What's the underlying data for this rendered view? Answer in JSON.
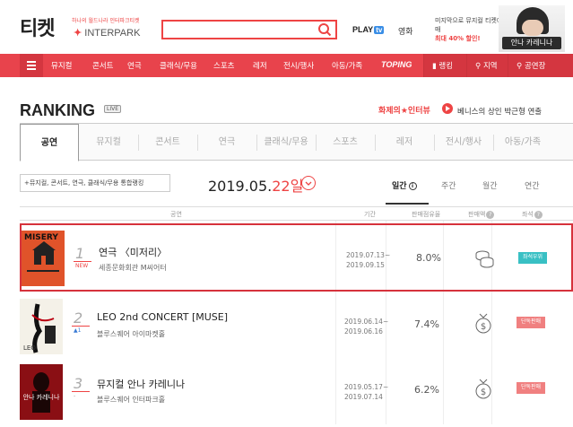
{
  "header": {
    "logo": "티켓",
    "logo_tagline": "하나의 월드나라 인터파크티켓",
    "logo_brand": "INTERPARK",
    "search_placeholder": "",
    "playtv": "PLAY",
    "playtv_badge": "tv",
    "movie": "영화",
    "ad_line1": "미지막으로 뮤지컬 티켓예매",
    "ad_line2": "최대 40% 할인!",
    "ad_banner_label": "안나 카레니나"
  },
  "nav": {
    "items": [
      "뮤지컬",
      "콘서트",
      "연극",
      "클래식/무용",
      "스포츠",
      "레저",
      "전시/행사",
      "아동/가족",
      "TOPING"
    ],
    "right_items": [
      "랭킹",
      "지역",
      "공연장"
    ]
  },
  "ranking": {
    "title": "RANKING",
    "live_badge": "LIVE",
    "banner_title": "화제의★인터뷰",
    "banner_sub": "베니스의 상인 박근형 연출",
    "tabs": [
      "공연",
      "뮤지컬",
      "콘서트",
      "연극",
      "클래식/무용",
      "스포츠",
      "레저",
      "전시/행사",
      "아동/가족"
    ],
    "filter_text": "+뮤지컬, 콘서트, 연극, 클래식/무용 통합랭킹",
    "date_prefix": "2019.05.",
    "date_day": "22일",
    "periods": [
      "일간",
      "주간",
      "월간",
      "연간"
    ],
    "columns": {
      "performance": "공연",
      "period": "기간",
      "share": "판매점유율",
      "sales_status": "판매액",
      "seat": "좌석"
    },
    "rows": [
      {
        "rank": "1",
        "change": "NEW",
        "title": "연극 〈미저리〉",
        "venue": "세종문화회관 M씨어터",
        "date_start": "2019.07.13~",
        "date_end": "2019.09.15",
        "share": "8.0%",
        "badge": "좌석우위",
        "badge_color": "#39c0c4",
        "icon": "coins-icon",
        "poster_text": "MISERY"
      },
      {
        "rank": "2",
        "change": "▲1",
        "title": "LEO 2nd CONCERT [MUSE]",
        "venue": "블루스퀘어 아이마켓홀",
        "date_start": "2019.06.14~",
        "date_end": "2019.06.16",
        "share": "7.4%",
        "badge": "단독판매",
        "badge_color": "#f08080",
        "icon": "money-bag-icon",
        "poster_text": "LEO"
      },
      {
        "rank": "3",
        "change": "-",
        "title": "뮤지컬 안나 카레니나",
        "venue": "블루스퀘어 인터파크홀",
        "date_start": "2019.05.17~",
        "date_end": "2019.07.14",
        "share": "6.2%",
        "badge": "단독판매",
        "badge_color": "#f08080",
        "icon": "money-bag-icon",
        "poster_text": "안나 카레니나"
      }
    ]
  }
}
